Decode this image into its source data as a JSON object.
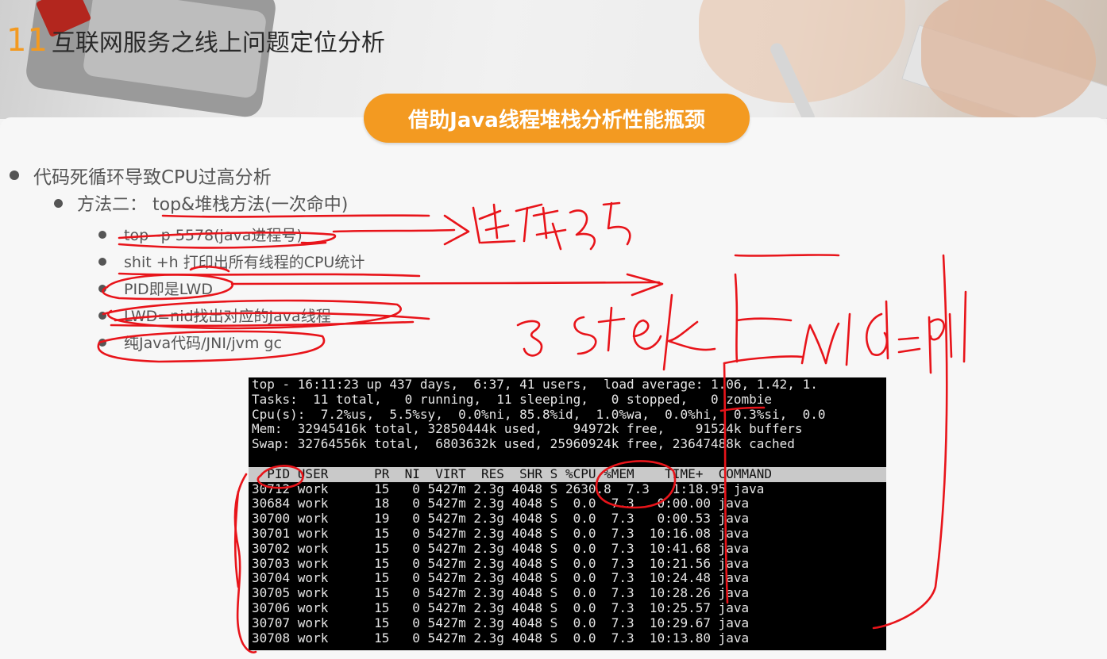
{
  "slide": {
    "number": "11",
    "title": "互联网服务之线上问题定位分析",
    "pill": "借助Java线程堆栈分析性能瓶颈"
  },
  "bullets": {
    "l1": "代码死循环导致CPU过高分析",
    "l2": "方法二：  top&堆栈方法(一次命中)",
    "l3": [
      "top –p 5578(java进程号)",
      "shit +h 打印出所有线程的CPU统计",
      "PID即是LWD",
      "LWD=nid找出对应的Java线程",
      "纯Java代码/JNI/jvm gc"
    ]
  },
  "terminal": {
    "summary": [
      "top - 16:11:23 up 437 days,  6:37, 41 users,  load average: 1.06, 1.42, 1.",
      "Tasks:  11 total,   0 running,  11 sleeping,   0 stopped,   0 zombie",
      "Cpu(s):  7.2%us,  5.5%sy,  0.0%ni, 85.8%id,  1.0%wa,  0.0%hi,  0.3%si,  0.0",
      "Mem:  32945416k total, 32850444k used,    94972k free,    91524k buffers",
      "Swap: 32764556k total,  6803632k used, 25960924k free, 23647488k cached"
    ],
    "columns": "  PID USER      PR  NI  VIRT  RES  SHR S %CPU %MEM    TIME+  COMMAND",
    "rows": [
      "30712 work      15   0 5427m 2.3g 4048 S 2630.8  7.3   1:18.95 java",
      "30684 work      18   0 5427m 2.3g 4048 S  0.0  7.3   0:00.00 java",
      "30700 work      19   0 5427m 2.3g 4048 S  0.0  7.3   0:00.53 java",
      "30701 work      15   0 5427m 2.3g 4048 S  0.0  7.3  10:16.08 java",
      "30702 work      15   0 5427m 2.3g 4048 S  0.0  7.3  10:41.68 java",
      "30703 work      15   0 5427m 2.3g 4048 S  0.0  7.3  10:21.56 java",
      "30704 work      15   0 5427m 2.3g 4048 S  0.0  7.3  10:24.48 java",
      "30705 work      15   0 5427m 2.3g 4048 S  0.0  7.3  10:28.26 java",
      "30706 work      15   0 5427m 2.3g 4048 S  0.0  7.3  10:25.57 java",
      "30707 work      15   0 5427m 2.3g 4048 S  0.0  7.3  10:29.67 java",
      "30708 work      15   0 5427m 2.3g 4048 S  0.0  7.3  10:13.80 java"
    ]
  },
  "colors": {
    "accent": "#f39a21",
    "annotation": "#e8141a",
    "terminal_bg": "#000000"
  }
}
